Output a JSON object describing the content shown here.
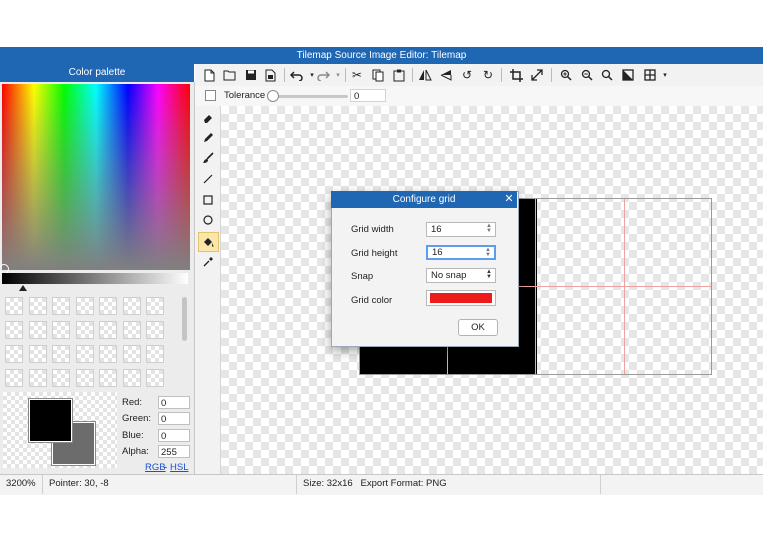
{
  "window": {
    "title": "Tilemap Source Image Editor: Tilemap"
  },
  "palette": {
    "header": "Color palette",
    "channels": [
      {
        "label": "Red:",
        "value": "0"
      },
      {
        "label": "Green:",
        "value": "0"
      },
      {
        "label": "Blue:",
        "value": "0"
      },
      {
        "label": "Alpha:",
        "value": "255"
      }
    ],
    "rgb_link": "RGB",
    "separator": "-",
    "hsl_link": "HSL",
    "primary_color": "#000000",
    "secondary_color": "#6c6c6c"
  },
  "toolbar": {
    "icons": [
      "new-file-icon",
      "open-folder-icon",
      "save-icon",
      "save-as-icon",
      "undo-icon",
      "redo-icon",
      "cut-icon",
      "copy-icon",
      "paste-icon",
      "flip-horizontal-icon",
      "flip-vertical-icon",
      "rotate-left-icon",
      "rotate-right-icon",
      "crop-icon",
      "resize-icon",
      "zoom-in-icon",
      "zoom-out-icon",
      "zoom-fit-icon",
      "zoom-actual-icon",
      "grid-icon"
    ]
  },
  "options_bar": {
    "tolerance_label": "Tolerance",
    "tolerance_value": "0"
  },
  "tools": [
    "eraser-icon",
    "pencil-icon",
    "brush-icon",
    "line-icon",
    "rectangle-icon",
    "ellipse-icon",
    "fill-bucket-icon",
    "eyedropper-icon"
  ],
  "active_tool": "fill-bucket-icon",
  "dialog": {
    "title": "Configure grid",
    "close_glyph": "✕",
    "grid_width_label": "Grid width",
    "grid_width_value": "16",
    "grid_height_label": "Grid height",
    "grid_height_value": "16",
    "snap_label": "Snap",
    "snap_value": "No snap",
    "grid_color_label": "Grid color",
    "grid_color": "#ee1b1b",
    "ok_label": "OK"
  },
  "status": {
    "zoom": "3200%",
    "pointer": "Pointer: 30, -8",
    "size_format": "Size: 32x16   Export Format: PNG"
  }
}
